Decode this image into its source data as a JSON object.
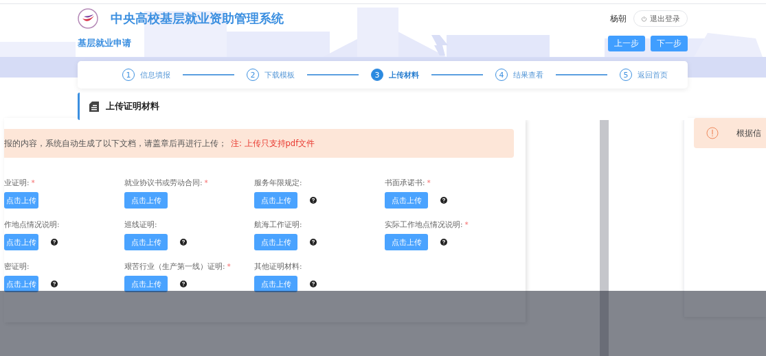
{
  "header": {
    "title": "中央高校基层就业资助管理系统",
    "subtitle": "基层就业申请",
    "user": "杨朝",
    "logout": "退出登录",
    "buttons": [
      "上一步",
      "下一步"
    ]
  },
  "steps": [
    {
      "number": "1",
      "label": "信息填报",
      "selected": false
    },
    {
      "number": "2",
      "label": "下载模板",
      "selected": false
    },
    {
      "number": "3",
      "label": "上传材料",
      "selected": true
    },
    {
      "number": "4",
      "label": "结果查看",
      "selected": false
    },
    {
      "number": "5",
      "label": "返回首页",
      "selected": false
    }
  ],
  "section": {
    "title": "上传证明材料"
  },
  "alert": {
    "text": "报的内容，系统自动生成了以下文档，请盖章后再进行上传；",
    "note": "注: 上传只支持pdf文件"
  },
  "uploads": [
    {
      "label": "业证明:",
      "mark": "*",
      "help": false,
      "button": "点击上传"
    },
    {
      "label": "就业协议书或劳动合同:",
      "mark": "*",
      "help": false,
      "button": "点击上传"
    },
    {
      "label": "服务年限规定:",
      "help": true,
      "button": "点击上传"
    },
    {
      "label": "书面承诺书:",
      "mark": "*",
      "help": true,
      "button": "点击上传"
    },
    {
      "label": "作地点情况说明:",
      "help": true,
      "button": "点击上传"
    },
    {
      "label": "巡线证明:",
      "help": true,
      "button": "点击上传"
    },
    {
      "label": "航海工作证明:",
      "help": true,
      "button": "点击上传"
    },
    {
      "label": "实际工作地点情况说明:",
      "mark": "*",
      "help": true,
      "button": "点击上传"
    },
    {
      "label": "密证明:",
      "help": true,
      "button": "点击上传"
    },
    {
      "label": "艰苦行业（生产第一线）证明:",
      "mark": "*",
      "help": true,
      "button": "点击上传"
    },
    {
      "label": "其他证明材料:",
      "help": true,
      "button": "点击上传"
    }
  ],
  "side_alert": {
    "text": "根据信"
  }
}
